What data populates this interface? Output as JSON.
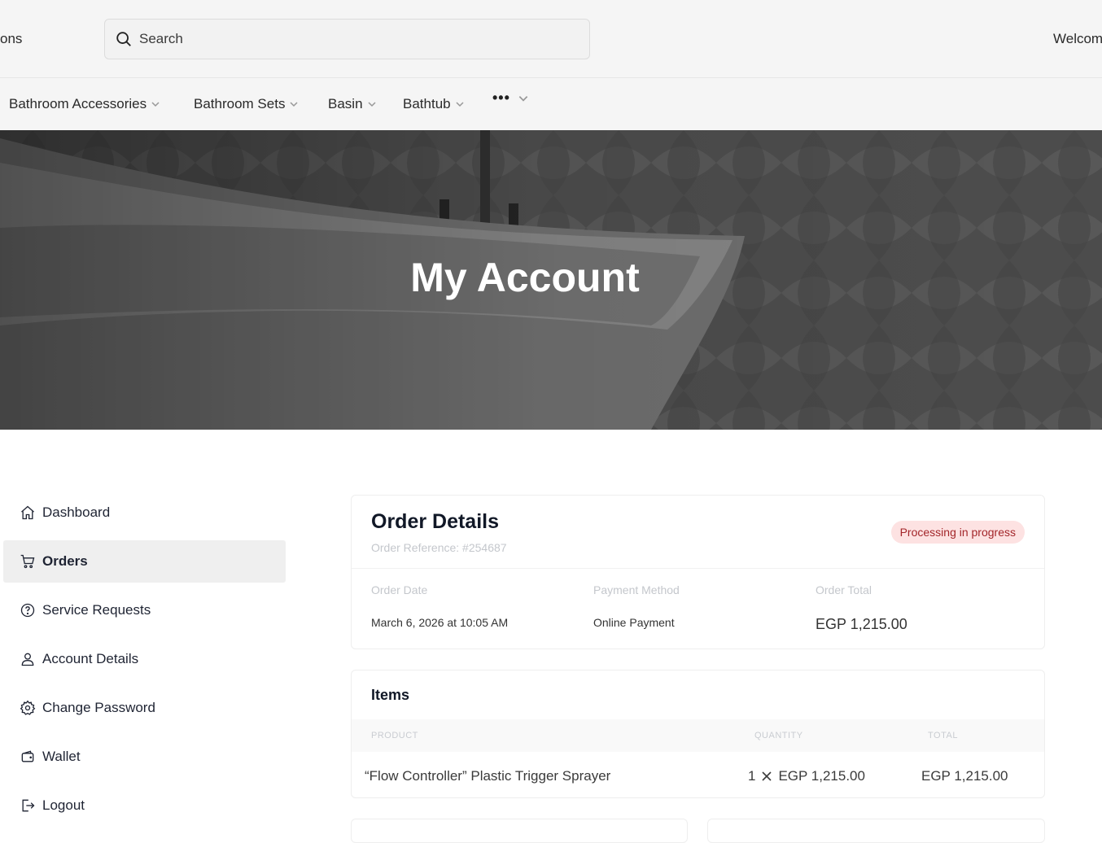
{
  "topbar": {
    "left_text": "ons",
    "search_placeholder": "Search",
    "welcome_text": "Welcom"
  },
  "categories": [
    {
      "label": "Bathroom Accessories"
    },
    {
      "label": "Bathroom Sets"
    },
    {
      "label": "Basin"
    },
    {
      "label": "Bathtub"
    }
  ],
  "more_label": "•••",
  "hero": {
    "title": "My Account"
  },
  "sidebar": {
    "items": [
      {
        "label": "Dashboard",
        "icon": "home-icon"
      },
      {
        "label": "Orders",
        "icon": "cart-icon",
        "active": true
      },
      {
        "label": "Service Requests",
        "icon": "help-circle-icon"
      },
      {
        "label": "Account Details",
        "icon": "user-icon"
      },
      {
        "label": "Change Password",
        "icon": "gear-icon"
      },
      {
        "label": "Wallet",
        "icon": "wallet-icon"
      },
      {
        "label": "Logout",
        "icon": "logout-icon"
      }
    ]
  },
  "order": {
    "title": "Order Details",
    "reference": "Order Reference: #254687",
    "status": "Processing in progress",
    "date_label": "Order Date",
    "date_value": "March 6, 2026 at 10:05 AM",
    "payment_label": "Payment Method",
    "payment_value": "Online Payment",
    "total_label": "Order Total",
    "total_value": "EGP 1,215.00"
  },
  "items": {
    "title": "Items",
    "columns": {
      "product": "PRODUCT",
      "quantity": "QUANTITY",
      "total": "TOTAL"
    },
    "rows": [
      {
        "product": "“Flow Controller” Plastic Trigger Sprayer",
        "qty": "1",
        "unit_price": "EGP 1,215.00",
        "total": "EGP 1,215.00"
      }
    ]
  },
  "colors": {
    "badge_bg": "#fde2e2",
    "badge_text": "#a3262a",
    "active_bg": "#efefef"
  }
}
